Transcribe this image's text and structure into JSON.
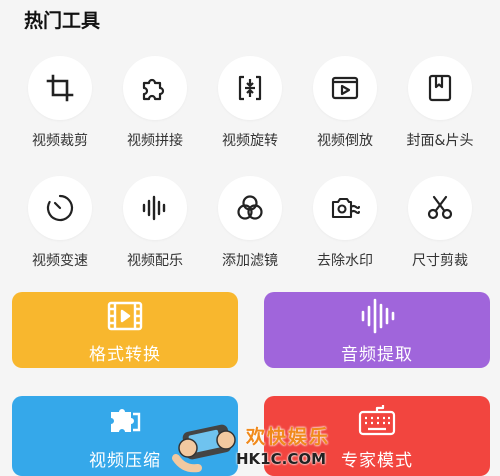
{
  "section": {
    "title": "热门工具"
  },
  "tools": [
    {
      "label": "视频裁剪",
      "icon": "crop-icon"
    },
    {
      "label": "视频拼接",
      "icon": "puzzle-icon"
    },
    {
      "label": "视频旋转",
      "icon": "rotate-icon"
    },
    {
      "label": "视频倒放",
      "icon": "reverse-play-icon"
    },
    {
      "label": "封面&片头",
      "icon": "bookmark-icon"
    },
    {
      "label": "视频变速",
      "icon": "speedometer-icon"
    },
    {
      "label": "视频配乐",
      "icon": "sound-wave-icon"
    },
    {
      "label": "添加滤镜",
      "icon": "filter-icon"
    },
    {
      "label": "去除水印",
      "icon": "camera-wave-icon"
    },
    {
      "label": "尺寸剪裁",
      "icon": "scissors-icon"
    }
  ],
  "cards": [
    {
      "label": "格式转换",
      "icon": "film-icon",
      "color": "#f8b72e"
    },
    {
      "label": "音频提取",
      "icon": "audio-bars-icon",
      "color": "#a065db"
    },
    {
      "label": "视频压缩",
      "icon": "compress-puzzle-icon",
      "color": "#35a8ea"
    },
    {
      "label": "专家模式",
      "icon": "keyboard-icon",
      "color": "#f2453f"
    }
  ],
  "watermark": {
    "line1": "欢快娱乐",
    "line2": "HK1C.COM"
  }
}
